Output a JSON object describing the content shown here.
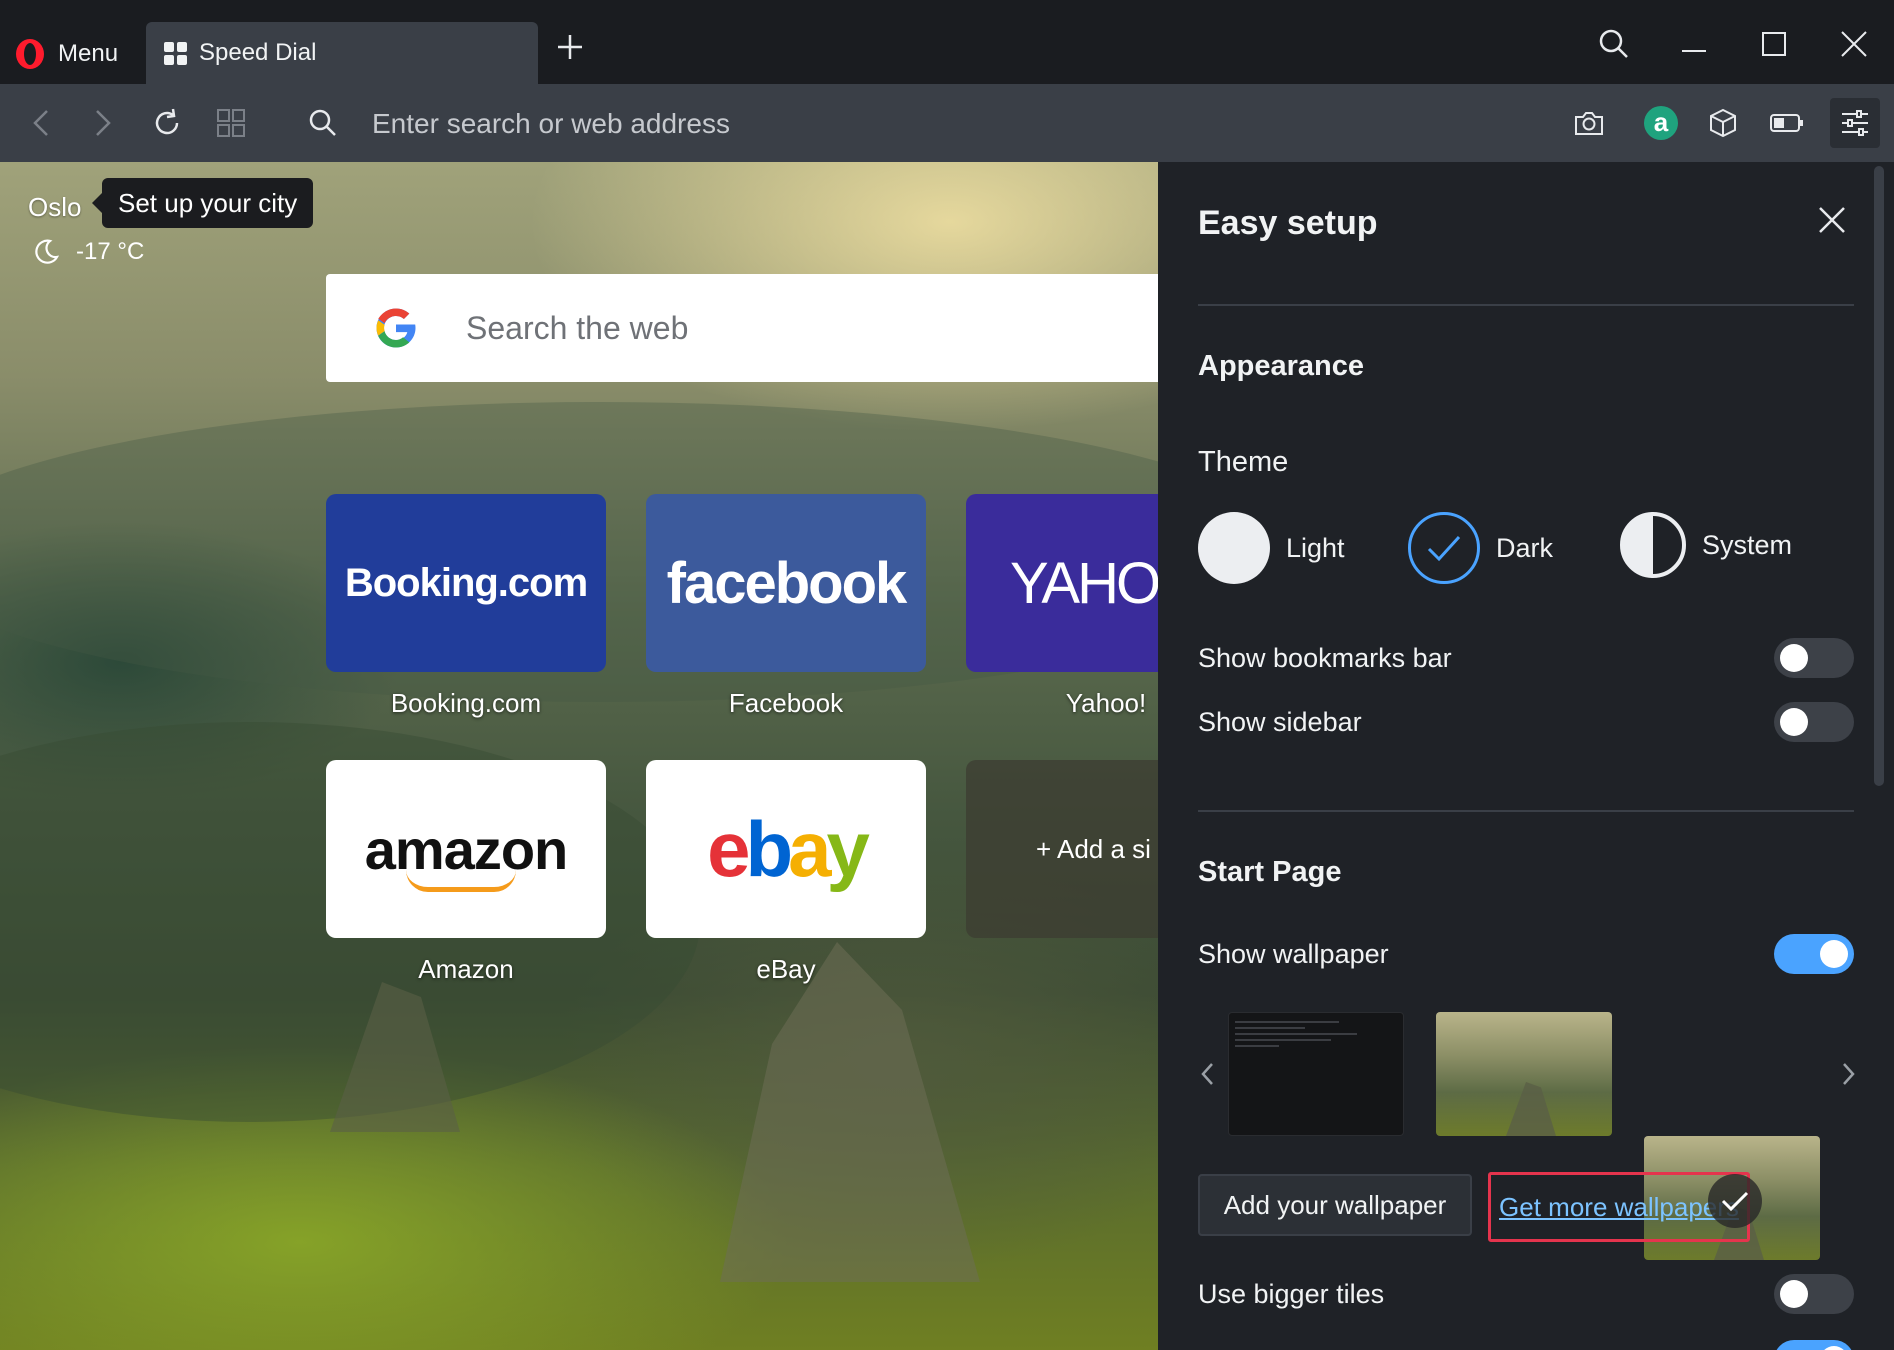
{
  "tabbar": {
    "menu_label": "Menu",
    "tab_title": "Speed Dial"
  },
  "toolbar": {
    "address_placeholder": "Enter search or web address"
  },
  "weather": {
    "city": "Oslo",
    "setup_tip": "Set up your city",
    "temperature": "-17 °C"
  },
  "search": {
    "placeholder": "Search the web"
  },
  "speed_dial": {
    "tiles": [
      {
        "logo": "Booking.com",
        "label": "Booking.com",
        "color": "#213d9a"
      },
      {
        "logo": "facebook",
        "label": "Facebook",
        "color": "#3c5a9c"
      },
      {
        "logo": "YAHOO",
        "label": "Yahoo!",
        "color": "#3a2c9b"
      },
      {
        "logo": "amazon",
        "label": "Amazon",
        "color": "#ffffff"
      },
      {
        "logo": "ebay",
        "label": "eBay",
        "color": "#ffffff"
      }
    ],
    "add_site_label": "+  Add a si"
  },
  "easy_setup": {
    "title": "Easy setup",
    "appearance": {
      "heading": "Appearance",
      "theme_label": "Theme",
      "themes": [
        {
          "label": "Light",
          "selected": false
        },
        {
          "label": "Dark",
          "selected": true
        },
        {
          "label": "System",
          "selected": false
        }
      ],
      "show_bookmarks_bar": {
        "label": "Show bookmarks bar",
        "on": false
      },
      "show_sidebar": {
        "label": "Show sidebar",
        "on": false
      }
    },
    "start_page": {
      "heading": "Start Page",
      "show_wallpaper": {
        "label": "Show wallpaper",
        "on": true
      },
      "add_wallpaper_button": "Add your wallpaper",
      "get_more_wallpapers_link": "Get more wallpapers",
      "use_bigger_tiles": {
        "label": "Use bigger tiles",
        "on": false
      }
    }
  },
  "colors": {
    "accent": "#4aa3ff",
    "opera_red": "#ff1b2d",
    "highlight_border": "#e5344d",
    "panel_bg": "#1f2227"
  }
}
